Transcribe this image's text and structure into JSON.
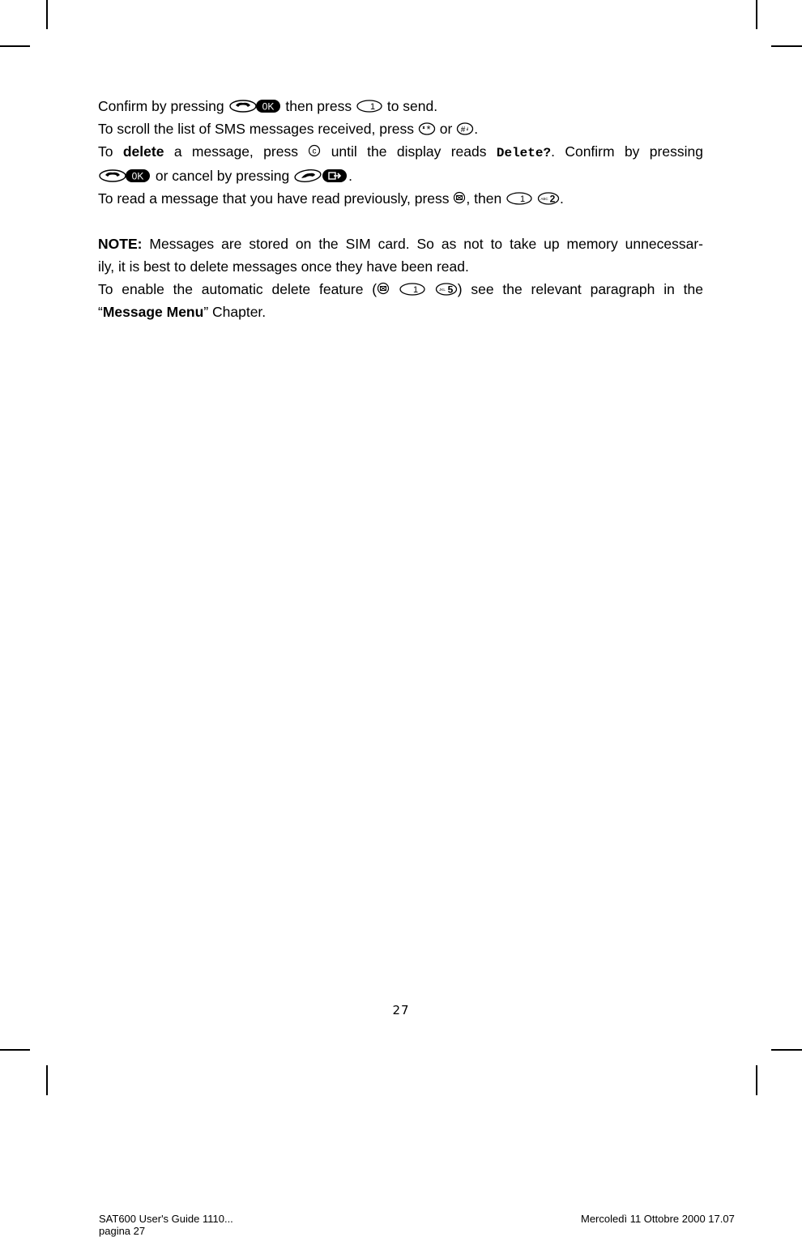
{
  "paragraph1": {
    "line1": {
      "pre": "Confirm by pressing",
      "mid": "then press",
      "post": "to send."
    },
    "line2": {
      "pre": "To scroll the list of SMS messages received, press",
      "mid": "or",
      "post": "."
    },
    "line3": {
      "pre": "To",
      "bold": "delete",
      "mid": "a message, press",
      "mid2": "until the display reads",
      "display": "Delete?",
      "post": ". Confirm by pressing"
    },
    "line4": {
      "mid": "or cancel by pressing",
      "post": "."
    },
    "line5": {
      "pre": "To read a message that you have read previously, press",
      "mid": ", then",
      "post": "."
    }
  },
  "note": {
    "label": "NOTE:",
    "text": " Messages are stored on the SIM card. So as not to take up memory unnecessarily, it is best to delete messages once they have been read.",
    "text_line1": " Messages are stored on the SIM card. So as not to take up memory unnecessar-",
    "text_line2": "ily, it is best to delete messages once they have been read.",
    "auto_delete": {
      "pre": "To enable the automatic delete feature (",
      "post": ") see the relevant paragraph in the",
      "quote_open": "“",
      "menu": "Message Menu",
      "quote_close": "”",
      "tail": " Chapter."
    }
  },
  "keys": {
    "ok": "0K",
    "one": "1",
    "star": "*",
    "hash": "#",
    "c": "c",
    "abc2": "2",
    "abc2_small": "ABC",
    "jkl5": "5",
    "jkl5_small": "JKL"
  },
  "page_number": "27",
  "footer": {
    "left_line1": "SAT600 User's Guide 1110...",
    "left_line2": "pagina 27",
    "right": "Mercoledì 11 Ottobre 2000 17.07"
  }
}
